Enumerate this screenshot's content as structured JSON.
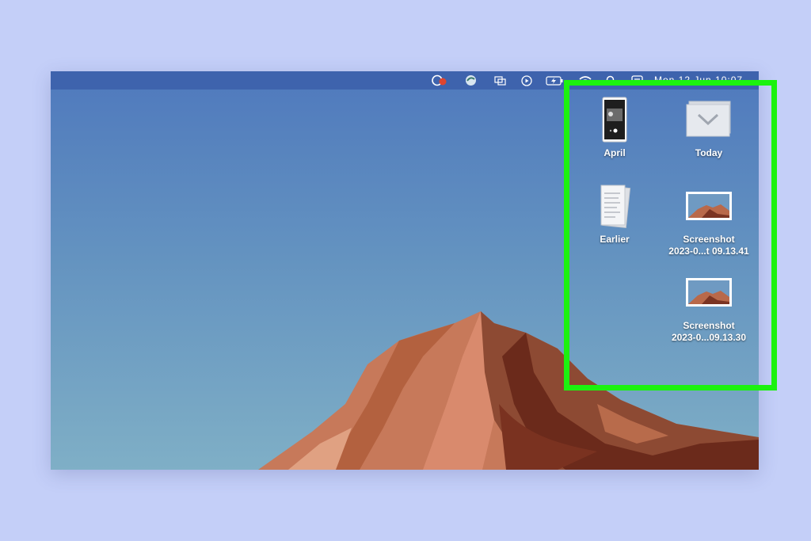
{
  "menubar": {
    "icons": [
      "screen-share-icon",
      "app-globe-icon",
      "window-icon",
      "play-icon",
      "battery-icon",
      "wifi-icon",
      "search-icon",
      "control-center-icon"
    ],
    "clock_text": "Mon 12 Jun  10:07"
  },
  "desktop": {
    "items": [
      {
        "label": "April",
        "kind": "stack",
        "icon": "phone-screenshot-icon"
      },
      {
        "label": "Today",
        "kind": "stack",
        "icon": "folder-stack-icon"
      },
      {
        "label": "Earlier",
        "kind": "stack",
        "icon": "document-stack-icon"
      },
      {
        "label_line1": "Screenshot",
        "label_line2": "2023-0...t 09.13.41",
        "kind": "file",
        "icon": "image-thumbnail-icon"
      },
      {
        "label_line1": "Screenshot",
        "label_line2": "2023-0...09.13.30",
        "kind": "file",
        "icon": "image-thumbnail-icon"
      }
    ]
  },
  "annotation": {
    "highlight_color": "#1cf20f"
  }
}
